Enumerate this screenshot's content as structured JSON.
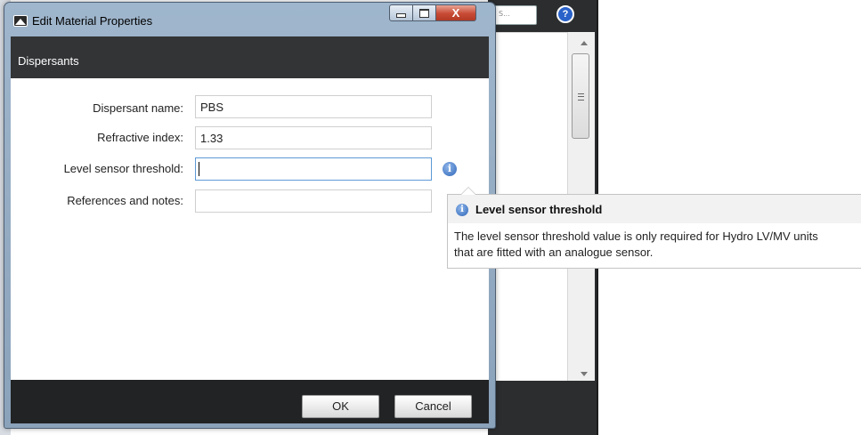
{
  "window": {
    "title": "Edit Material Properties",
    "close_glyph": "X",
    "title_icon": "material-icon"
  },
  "background": {
    "search_placeholder": "S...",
    "help_icon_glyph": "?"
  },
  "dialog": {
    "header": "Dispersants",
    "fields": [
      {
        "label": "Dispersant name:",
        "value": "PBS"
      },
      {
        "label": "Refractive index:",
        "value": "1.33"
      },
      {
        "label": "Level sensor threshold:",
        "value": ""
      },
      {
        "label": "References and notes:",
        "value": ""
      }
    ],
    "info_glyph": "i",
    "ok_label": "OK",
    "cancel_label": "Cancel"
  },
  "tooltip": {
    "icon_glyph": "i",
    "title": "Level sensor threshold",
    "line1": "The level sensor threshold value is only required for Hydro LV/MV units",
    "line2": "that are fitted with an analogue sensor."
  },
  "colors": {
    "header_band": "#333436",
    "footer_band": "#222325",
    "focus_border": "#5d9ad6",
    "info_blue": "#2f66b8"
  }
}
